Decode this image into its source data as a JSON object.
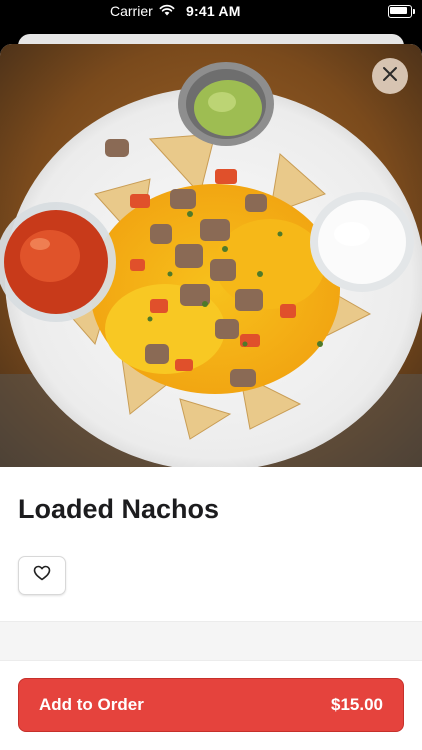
{
  "status_bar": {
    "carrier": "Carrier",
    "time": "9:41 AM",
    "battery_level": 1.0
  },
  "item": {
    "title": "Loaded Nachos",
    "image_alt": "Loaded nachos plate with salsa, guacamole and sour cream"
  },
  "actions": {
    "close_icon": "close-icon",
    "favorite_icon": "heart-outline-icon",
    "add_label": "Add to Order",
    "price": "$15.00"
  },
  "colors": {
    "accent": "#e5433d",
    "title": "#1c1c1e"
  }
}
